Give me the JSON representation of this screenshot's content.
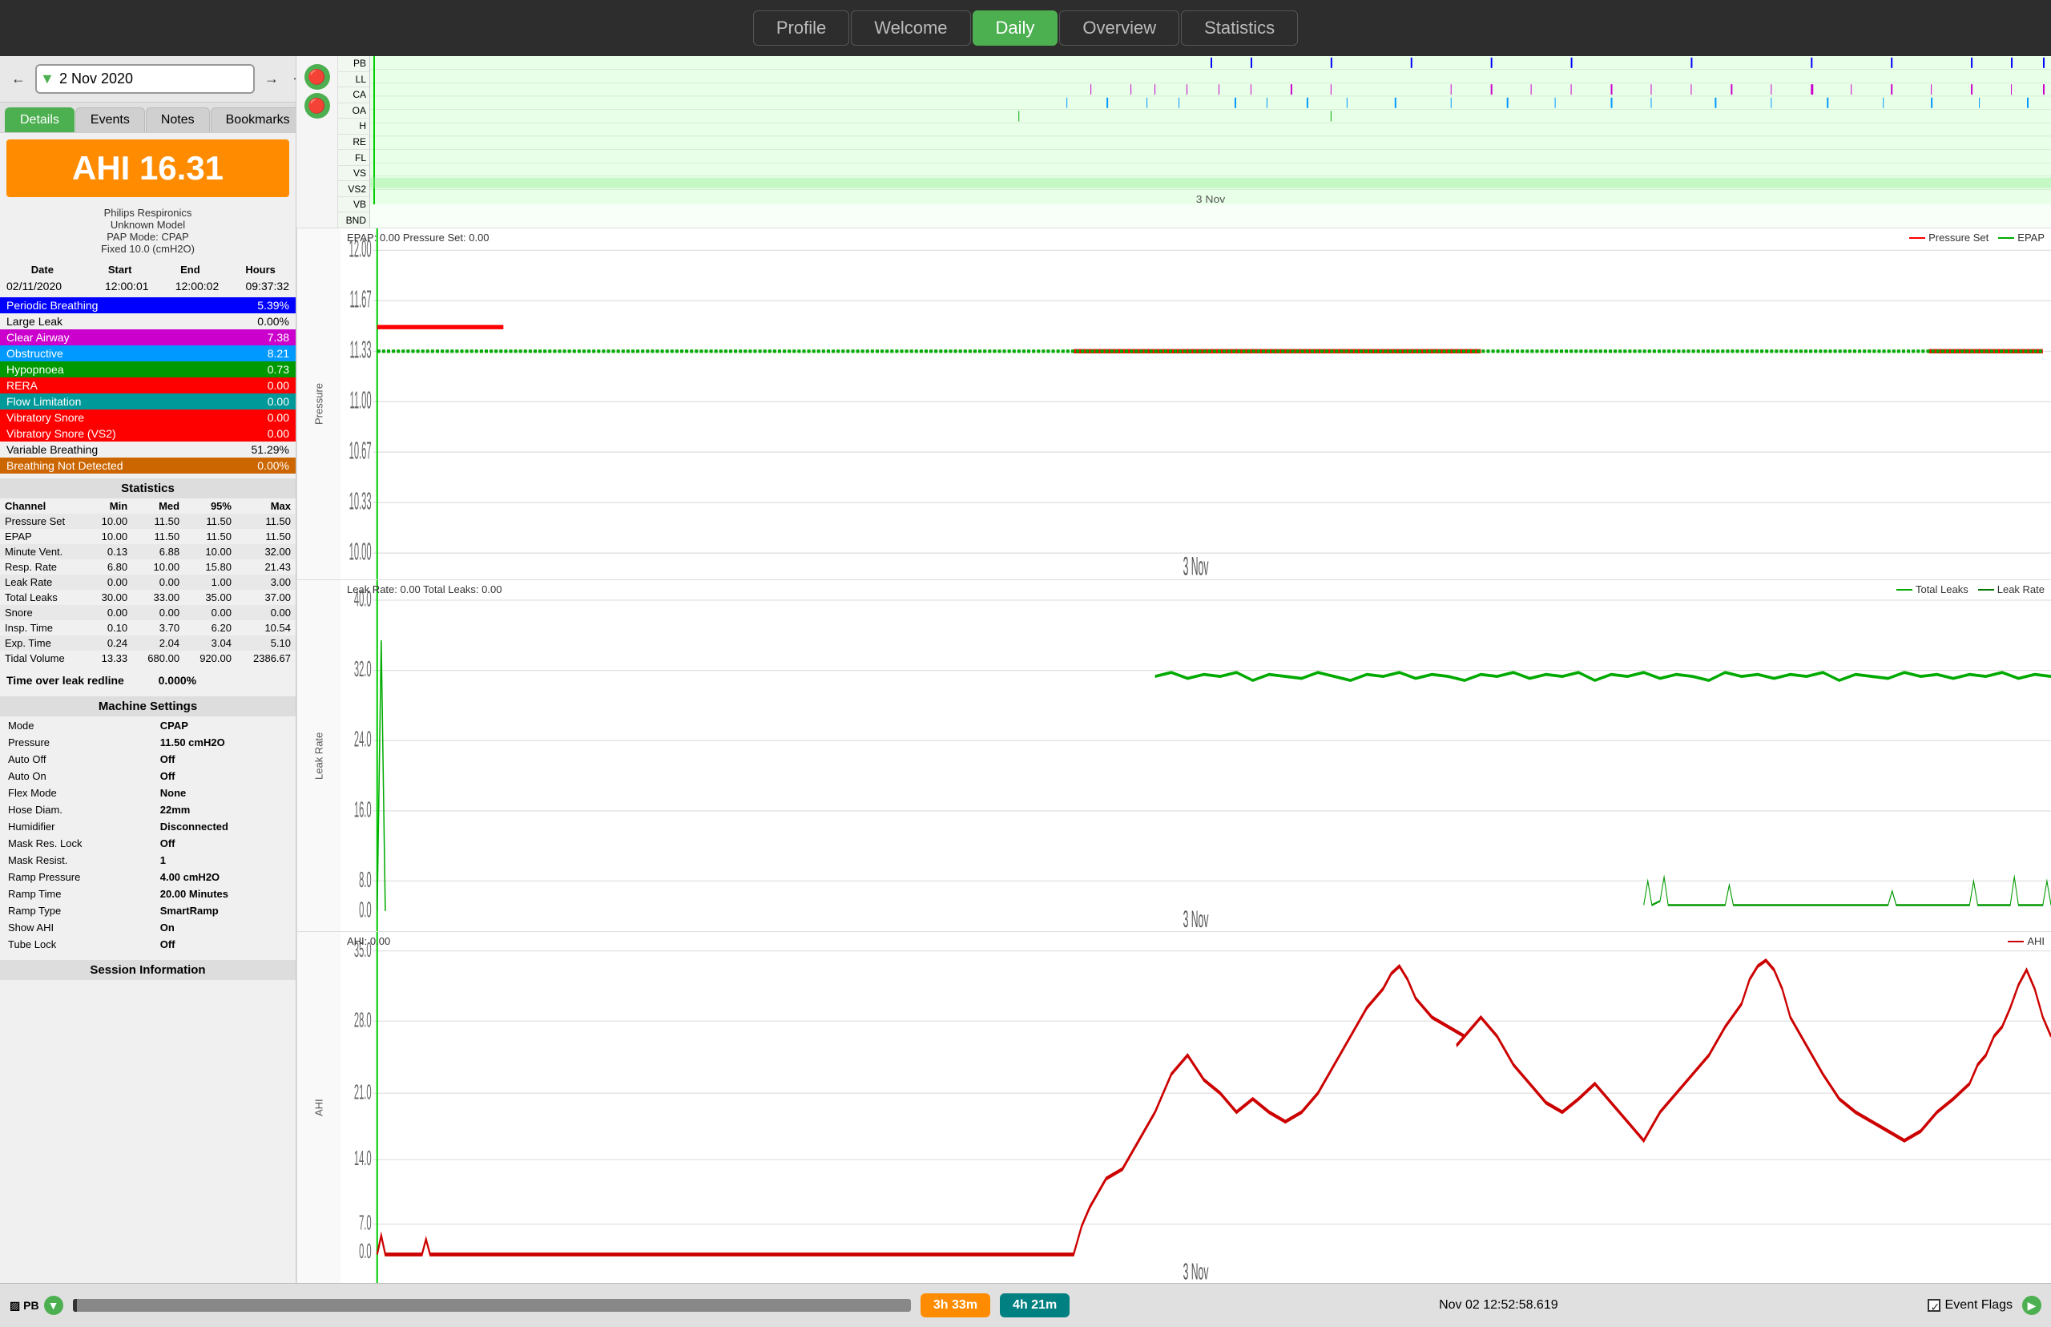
{
  "nav": {
    "tabs": [
      {
        "id": "profile",
        "label": "Profile",
        "active": false
      },
      {
        "id": "welcome",
        "label": "Welcome",
        "active": false
      },
      {
        "id": "daily",
        "label": "Daily",
        "active": true
      },
      {
        "id": "overview",
        "label": "Overview",
        "active": false
      },
      {
        "id": "statistics",
        "label": "Statistics",
        "active": false
      }
    ]
  },
  "left_panel": {
    "date": "2 Nov 2020",
    "tabs": [
      "Details",
      "Events",
      "Notes",
      "Bookmarks"
    ],
    "active_tab": "Details",
    "ahi": {
      "value": "AHI 16.31",
      "label": "Philips Respironics\nUnknown Model\nPAP Mode: CPAP\nFixed 10.0 (cmH2O)"
    },
    "session": {
      "headers": [
        "Date",
        "Start",
        "End",
        "Hours"
      ],
      "row": [
        "02/11/2020",
        "12:00:01",
        "12:00:02",
        "09:37:32"
      ]
    },
    "events": [
      {
        "label": "Periodic Breathing",
        "value": "5.39%",
        "class": "periodic"
      },
      {
        "label": "Large Leak",
        "value": "0.00%",
        "class": "large-leak"
      },
      {
        "label": "Clear Airway",
        "value": "7.38",
        "class": "clear-airway"
      },
      {
        "label": "Obstructive",
        "value": "8.21",
        "class": "obstructive"
      },
      {
        "label": "Hypopnoea",
        "value": "0.73",
        "class": "hypopnoea"
      },
      {
        "label": "RERA",
        "value": "0.00",
        "class": "rera"
      },
      {
        "label": "Flow Limitation",
        "value": "0.00",
        "class": "flow-lim"
      },
      {
        "label": "Vibratory Snore",
        "value": "0.00",
        "class": "vibr-snore"
      },
      {
        "label": "Vibratory Snore (VS2)",
        "value": "0.00",
        "class": "vibr-snore2"
      },
      {
        "label": "Variable Breathing",
        "value": "51.29%",
        "class": "variable"
      },
      {
        "label": "Breathing Not Detected",
        "value": "0.00%",
        "class": "bnd"
      }
    ],
    "stats": {
      "title": "Statistics",
      "headers": [
        "Channel",
        "Min",
        "Med",
        "95%",
        "Max"
      ],
      "rows": [
        [
          "Pressure Set",
          "10.00",
          "11.50",
          "11.50",
          "11.50"
        ],
        [
          "EPAP",
          "10.00",
          "11.50",
          "11.50",
          "11.50"
        ],
        [
          "Minute Vent.",
          "0.13",
          "6.88",
          "10.00",
          "32.00"
        ],
        [
          "Resp. Rate",
          "6.80",
          "10.00",
          "15.80",
          "21.43"
        ],
        [
          "Leak Rate",
          "0.00",
          "0.00",
          "1.00",
          "3.00"
        ],
        [
          "Total Leaks",
          "30.00",
          "33.00",
          "35.00",
          "37.00"
        ],
        [
          "Snore",
          "0.00",
          "0.00",
          "0.00",
          "0.00"
        ],
        [
          "Insp. Time",
          "0.10",
          "3.70",
          "6.20",
          "10.54"
        ],
        [
          "Exp. Time",
          "0.24",
          "2.04",
          "3.04",
          "5.10"
        ],
        [
          "Tidal Volume",
          "13.33",
          "680.00",
          "920.00",
          "2386.67"
        ]
      ]
    },
    "leak_line": "Time over leak redline          0.000%",
    "machine": {
      "title": "Machine Settings",
      "rows": [
        [
          "Mode",
          "CPAP"
        ],
        [
          "Pressure",
          "11.50 cmH2O"
        ],
        [
          "Auto Off",
          "Off"
        ],
        [
          "Auto On",
          "Off"
        ],
        [
          "Flex Mode",
          "None"
        ],
        [
          "Hose Diam.",
          "22mm"
        ],
        [
          "Humidifier",
          "Disconnected"
        ],
        [
          "Mask Res. Lock",
          "Off"
        ],
        [
          "Mask Resist.",
          "1"
        ],
        [
          "Ramp Pressure",
          "4.00 cmH2O"
        ],
        [
          "Ramp Time",
          "20.00 Minutes"
        ],
        [
          "Ramp Type",
          "SmartRamp"
        ],
        [
          "Show AHI",
          "On"
        ],
        [
          "Tube Lock",
          "Off"
        ]
      ]
    },
    "session_info": {
      "title": "Session Information"
    }
  },
  "charts": {
    "event_flags": {
      "header": "",
      "labels": [
        "PB",
        "LL",
        "CA",
        "OA",
        "H",
        "RE",
        "FL",
        "VS",
        "VS2",
        "VB",
        "BND"
      ],
      "date_label": "3 Nov"
    },
    "pressure": {
      "header": "EPAP: 0.00 Pressure Set: 0.00",
      "legend": [
        {
          "label": "Pressure Set",
          "color": "#ff0000"
        },
        {
          "label": "EPAP",
          "color": "#00aa00"
        }
      ],
      "ylabel": "Pressure",
      "yticks": [
        "10.00",
        "10.33",
        "10.67",
        "11.00",
        "11.33",
        "11.67",
        "12.00"
      ],
      "date_label": "3 Nov"
    },
    "leak": {
      "header": "Leak Rate: 0.00 Total Leaks: 0.00",
      "legend": [
        {
          "label": "Total Leaks",
          "color": "#00aa00"
        },
        {
          "label": "Leak Rate",
          "color": "#00aa00"
        }
      ],
      "ylabel": "Leak Rate",
      "yticks": [
        "0.0",
        "8.0",
        "16.0",
        "24.0",
        "32.0",
        "40.0"
      ],
      "date_label": "3 Nov"
    },
    "ahi": {
      "header": "AHI: 0.00",
      "legend": [
        {
          "label": "AHI",
          "color": "#cc0000"
        }
      ],
      "ylabel": "AHI",
      "yticks": [
        "0.0",
        "7.0",
        "14.0",
        "21.0",
        "28.0",
        "35.0"
      ],
      "date_label": "3 Nov"
    }
  },
  "bottom_bar": {
    "pb_label": "PB",
    "timestamp": "Nov 02 12:52:58.619",
    "event_flags_label": "Event Flags",
    "btn1": "3h 33m",
    "btn2": "4h 21m"
  }
}
